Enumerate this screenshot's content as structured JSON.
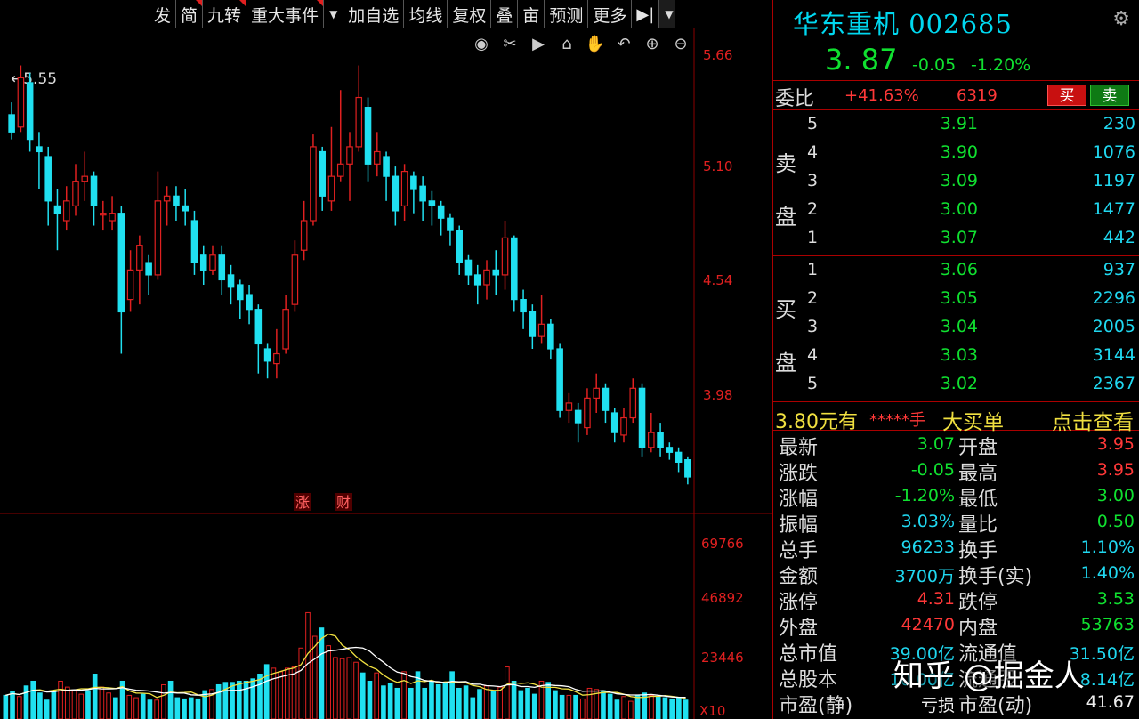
{
  "toolbar": {
    "items": [
      {
        "label": "发",
        "flag": false
      },
      {
        "label": "简",
        "flag": true
      },
      {
        "label": "九转",
        "flag": true
      },
      {
        "label": "重大事件",
        "flag": true
      },
      {
        "label": "加自选",
        "flag": false
      },
      {
        "label": "均线",
        "flag": false
      },
      {
        "label": "复权",
        "flag": false
      },
      {
        "label": "叠",
        "flag": false
      },
      {
        "label": "亩",
        "flag": false
      },
      {
        "label": "预测",
        "flag": false
      },
      {
        "label": "更多",
        "flag": false
      }
    ],
    "icons": [
      "dropdown-icon",
      "skip-end-icon",
      "dropdown-icon"
    ]
  },
  "chart": {
    "price_labels": [
      "5.66",
      "5.10",
      "4.54",
      "3.98"
    ],
    "volume_labels": [
      "69766",
      "46892",
      "23446"
    ],
    "high_marker": "5.55",
    "event_markers": [
      "涨",
      "财"
    ],
    "volume_unit": "X10",
    "control_icons": [
      "eye-icon",
      "scissors-icon",
      "play-icon",
      "lock-icon",
      "hand-icon",
      "undo-icon",
      "zoom-in-icon",
      "zoom-out-icon"
    ],
    "colors": {
      "up": "#e02020",
      "down": "#20e0f0",
      "ma1": "#f0e040",
      "ma2": "#ffffff",
      "grid": "#8b0000"
    }
  },
  "chart_data": {
    "type": "candlestick",
    "ylim": [
      3.75,
      5.7
    ],
    "candles": [
      [
        5.35,
        5.28,
        5.4,
        5.25
      ],
      [
        5.3,
        5.5,
        5.55,
        5.28
      ],
      [
        5.48,
        5.25,
        5.52,
        5.2
      ],
      [
        5.22,
        5.2,
        5.28,
        5.05
      ],
      [
        5.18,
        5.0,
        5.22,
        4.9
      ],
      [
        4.98,
        4.95,
        5.05,
        4.8
      ],
      [
        4.92,
        5.0,
        5.06,
        4.88
      ],
      [
        4.98,
        5.08,
        5.15,
        4.94
      ],
      [
        5.08,
        5.1,
        5.2,
        5.0
      ],
      [
        5.1,
        4.98,
        5.12,
        4.9
      ],
      [
        4.95,
        4.95,
        5.0,
        4.88
      ],
      [
        4.92,
        4.95,
        5.02,
        4.88
      ],
      [
        4.95,
        4.55,
        4.98,
        4.38
      ],
      [
        4.6,
        4.72,
        4.8,
        4.55
      ],
      [
        4.72,
        4.82,
        4.86,
        4.58
      ],
      [
        4.75,
        4.7,
        4.78,
        4.62
      ],
      [
        4.7,
        5.0,
        5.12,
        4.68
      ],
      [
        5.0,
        5.02,
        5.06,
        4.9
      ],
      [
        5.02,
        4.98,
        5.06,
        4.92
      ],
      [
        4.98,
        4.96,
        5.05,
        4.9
      ],
      [
        4.92,
        4.75,
        4.96,
        4.7
      ],
      [
        4.78,
        4.72,
        4.82,
        4.66
      ],
      [
        4.72,
        4.78,
        4.82,
        4.7
      ],
      [
        4.78,
        4.68,
        4.82,
        4.62
      ],
      [
        4.7,
        4.65,
        4.74,
        4.58
      ],
      [
        4.66,
        4.6,
        4.68,
        4.52
      ],
      [
        4.62,
        4.56,
        4.66,
        4.5
      ],
      [
        4.56,
        4.42,
        4.58,
        4.3
      ],
      [
        4.4,
        4.35,
        4.42,
        4.28
      ],
      [
        4.34,
        4.38,
        4.48,
        4.28
      ],
      [
        4.4,
        4.56,
        4.62,
        4.38
      ],
      [
        4.58,
        4.78,
        4.84,
        4.55
      ],
      [
        4.8,
        4.92,
        5.0,
        4.76
      ],
      [
        4.92,
        5.22,
        5.27,
        4.9
      ],
      [
        5.2,
        5.02,
        5.22,
        4.96
      ],
      [
        5.0,
        5.1,
        5.3,
        4.96
      ],
      [
        5.1,
        5.15,
        5.45,
        5.08
      ],
      [
        5.15,
        5.22,
        5.28,
        5.0
      ],
      [
        5.22,
        5.42,
        5.55,
        5.2
      ],
      [
        5.38,
        5.15,
        5.42,
        5.08
      ],
      [
        5.15,
        5.2,
        5.28,
        5.1
      ],
      [
        5.18,
        5.1,
        5.2,
        5.0
      ],
      [
        5.1,
        4.96,
        5.14,
        4.9
      ],
      [
        4.98,
        5.12,
        5.15,
        4.92
      ],
      [
        5.1,
        5.05,
        5.12,
        4.95
      ],
      [
        5.06,
        5.0,
        5.1,
        4.92
      ],
      [
        5.0,
        4.98,
        5.04,
        4.9
      ],
      [
        4.98,
        4.93,
        5.0,
        4.86
      ],
      [
        4.93,
        4.88,
        4.95,
        4.82
      ],
      [
        4.88,
        4.75,
        4.9,
        4.7
      ],
      [
        4.76,
        4.7,
        4.78,
        4.66
      ],
      [
        4.7,
        4.66,
        4.74,
        4.58
      ],
      [
        4.66,
        4.72,
        4.76,
        4.6
      ],
      [
        4.72,
        4.7,
        4.8,
        4.62
      ],
      [
        4.7,
        4.85,
        4.92,
        4.64
      ],
      [
        4.85,
        4.6,
        4.86,
        4.55
      ],
      [
        4.6,
        4.55,
        4.64,
        4.48
      ],
      [
        4.55,
        4.45,
        4.58,
        4.4
      ],
      [
        4.45,
        4.5,
        4.62,
        4.42
      ],
      [
        4.5,
        4.4,
        4.52,
        4.36
      ],
      [
        4.4,
        4.15,
        4.42,
        4.12
      ],
      [
        4.15,
        4.18,
        4.22,
        4.1
      ],
      [
        4.15,
        4.1,
        4.18,
        4.02
      ],
      [
        4.08,
        4.2,
        4.24,
        4.05
      ],
      [
        4.2,
        4.24,
        4.3,
        4.14
      ],
      [
        4.24,
        4.15,
        4.26,
        4.1
      ],
      [
        4.14,
        4.06,
        4.16,
        4.02
      ],
      [
        4.05,
        4.12,
        4.16,
        4.02
      ],
      [
        4.12,
        4.24,
        4.28,
        4.1
      ],
      [
        4.24,
        4.0,
        4.26,
        3.96
      ],
      [
        4.0,
        4.06,
        4.14,
        3.98
      ],
      [
        4.06,
        4.0,
        4.1,
        3.96
      ],
      [
        4.0,
        3.98,
        4.02,
        3.95
      ],
      [
        3.98,
        3.94,
        4.0,
        3.9
      ],
      [
        3.95,
        3.88,
        3.96,
        3.85
      ]
    ],
    "volume": {
      "values": [
        10000,
        11500,
        9500,
        14000,
        16000,
        11000,
        8000,
        12000,
        16000,
        13500,
        12000,
        10500,
        12000,
        19000,
        13500,
        11000,
        9000,
        16000,
        10000,
        9000,
        10500,
        8000,
        8000,
        14500,
        16000,
        9000,
        8500,
        9000,
        8500,
        12000,
        12500,
        14500,
        15500,
        15500,
        16000,
        16000,
        17000,
        19000,
        23000,
        21500,
        20000,
        21500,
        22000,
        30000,
        45000,
        35000,
        38500,
        31000,
        26000,
        25500,
        26000,
        24000,
        19500,
        16000,
        19500,
        14000,
        15000,
        13000,
        20000,
        13000,
        20000,
        13000,
        16000,
        14500,
        15000,
        20000,
        13000,
        14000,
        9000,
        12500,
        14000,
        11500,
        13500,
        22000,
        16000,
        12000,
        13000,
        10500,
        16000,
        15500,
        12000,
        10000,
        10000,
        10000,
        8500,
        13000,
        12500,
        12000,
        10500,
        8000,
        9500,
        7500,
        10000,
        11000,
        10000,
        9500,
        9000,
        8500,
        9000,
        8000
      ],
      "ylim": [
        0,
        70000
      ]
    }
  },
  "panel": {
    "title": "华东重机 002685",
    "price": "3. 87",
    "change": "-0.05",
    "change_pct": "-1.20%",
    "weibi_label": "委比",
    "weibi_ratio": "+41.63%",
    "weibi_diff": "6319",
    "buy_btn": "买",
    "sell_btn": "卖",
    "ask_label": [
      "卖",
      "盘"
    ],
    "bid_label": [
      "买",
      "盘"
    ],
    "asks": [
      {
        "level": "5",
        "price": "3.91",
        "vol": "230"
      },
      {
        "level": "4",
        "price": "3.90",
        "vol": "1076"
      },
      {
        "level": "3",
        "price": "3.09",
        "vol": "1197"
      },
      {
        "level": "2",
        "price": "3.00",
        "vol": "1477"
      },
      {
        "level": "1",
        "price": "3.07",
        "vol": "442"
      }
    ],
    "bids": [
      {
        "level": "1",
        "price": "3.06",
        "vol": "937"
      },
      {
        "level": "2",
        "price": "3.05",
        "vol": "2296"
      },
      {
        "level": "3",
        "price": "3.04",
        "vol": "2005"
      },
      {
        "level": "4",
        "price": "3.03",
        "vol": "3144"
      },
      {
        "level": "5",
        "price": "3.02",
        "vol": "2367"
      }
    ],
    "big_order": {
      "price": "3.80元有",
      "mid": "*****手",
      "label": "大买单",
      "link": "点击查看"
    },
    "stats": [
      {
        "l1": "最新",
        "v1": "3.07",
        "c1": "grn",
        "l2": "开盘",
        "v2": "3.95",
        "c2": "red"
      },
      {
        "l1": "涨跌",
        "v1": "-0.05",
        "c1": "grn",
        "l2": "最高",
        "v2": "3.95",
        "c2": "red"
      },
      {
        "l1": "涨幅",
        "v1": "-1.20%",
        "c1": "grn",
        "l2": "最低",
        "v2": "3.00",
        "c2": "grn"
      },
      {
        "l1": "振幅",
        "v1": "3.03%",
        "c1": "cyan",
        "l2": "量比",
        "v2": "0.50",
        "c2": "grn"
      },
      {
        "l1": "总手",
        "v1": "96233",
        "c1": "cyan",
        "l2": "换手",
        "v2": "1.10%",
        "c2": "cyan"
      },
      {
        "l1": "金额",
        "v1": "3700万",
        "c1": "cyan",
        "l2": "换手(实)",
        "v2": "1.40%",
        "c2": "cyan"
      },
      {
        "l1": "涨停",
        "v1": "4.31",
        "c1": "red",
        "l2": "跌停",
        "v2": "3.53",
        "c2": "grn"
      },
      {
        "l1": "外盘",
        "v1": "42470",
        "c1": "red",
        "l2": "内盘",
        "v2": "53763",
        "c2": "grn"
      },
      {
        "l1": "总市值",
        "v1": "39.00亿",
        "c1": "cyan",
        "l2": "流通值",
        "v2": "31.50亿",
        "c2": "cyan"
      },
      {
        "l1": "总股本",
        "v1": "10.00亿",
        "c1": "cyan",
        "l2": "流通股",
        "v2": "8.14亿",
        "c2": "cyan"
      },
      {
        "l1": "市盈(静)",
        "v1": "亏损",
        "c1": "white",
        "l2": "市盈(动)",
        "v2": "41.67",
        "c2": "white"
      }
    ]
  },
  "watermark": "知乎 @掘金人"
}
